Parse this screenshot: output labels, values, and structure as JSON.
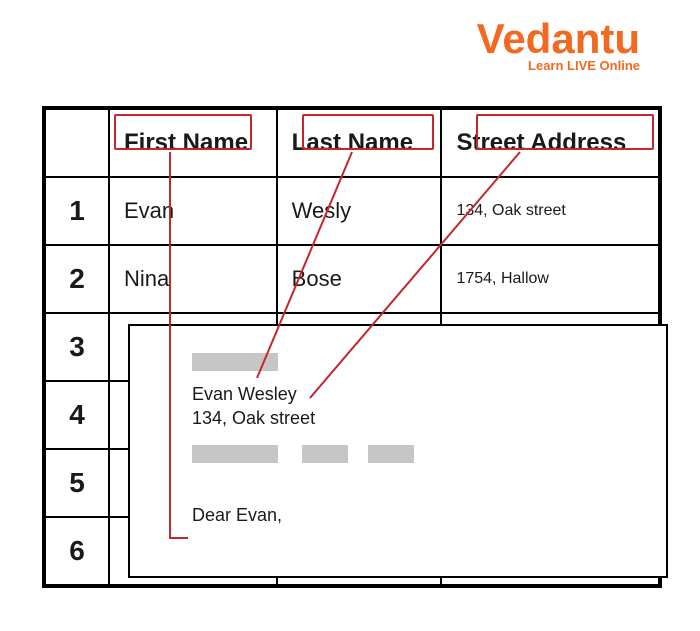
{
  "logo": {
    "main": "Vedantu",
    "sub": "Learn LIVE Online"
  },
  "headers": {
    "first": "First Name",
    "last": "Last Name",
    "street": "Street Address"
  },
  "rows": [
    {
      "n": "1",
      "first": "Evan",
      "last": "Wesly",
      "street": "134, Oak street"
    },
    {
      "n": "2",
      "first": "Nina",
      "last": "Bose",
      "street": "1754, Hallow"
    },
    {
      "n": "3"
    },
    {
      "n": "4"
    },
    {
      "n": "5"
    },
    {
      "n": "6"
    }
  ],
  "envelope": {
    "name": "Evan Wesley",
    "addr": "134, Oak street",
    "dear": "Dear Evan,"
  }
}
